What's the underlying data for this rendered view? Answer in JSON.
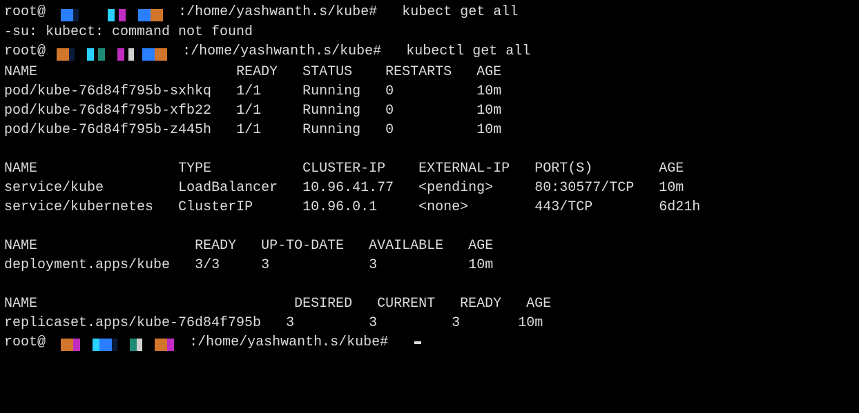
{
  "prompt": {
    "user": "root@",
    "path": ":/home/yashwanth.s/kube#",
    "cmd1": "kubect get all",
    "cmd2": "kubectl get all"
  },
  "err": "-su: kubect: command not found",
  "pods": {
    "hdr": {
      "name": "NAME",
      "ready": "READY",
      "status": "STATUS",
      "restarts": "RESTARTS",
      "age": "AGE"
    },
    "rows": [
      {
        "name": "pod/kube-76d84f795b-sxhkq",
        "ready": "1/1",
        "status": "Running",
        "restarts": "0",
        "age": "10m"
      },
      {
        "name": "pod/kube-76d84f795b-xfb22",
        "ready": "1/1",
        "status": "Running",
        "restarts": "0",
        "age": "10m"
      },
      {
        "name": "pod/kube-76d84f795b-z445h",
        "ready": "1/1",
        "status": "Running",
        "restarts": "0",
        "age": "10m"
      }
    ]
  },
  "svcs": {
    "hdr": {
      "name": "NAME",
      "type": "TYPE",
      "cip": "CLUSTER-IP",
      "eip": "EXTERNAL-IP",
      "ports": "PORT(S)",
      "age": "AGE"
    },
    "rows": [
      {
        "name": "service/kube",
        "type": "LoadBalancer",
        "cip": "10.96.41.77",
        "eip": "<pending>",
        "ports": "80:30577/TCP",
        "age": "10m"
      },
      {
        "name": "service/kubernetes",
        "type": "ClusterIP",
        "cip": "10.96.0.1",
        "eip": "<none>",
        "ports": "443/TCP",
        "age": "6d21h"
      }
    ]
  },
  "deps": {
    "hdr": {
      "name": "NAME",
      "ready": "READY",
      "u2d": "UP-TO-DATE",
      "avail": "AVAILABLE",
      "age": "AGE"
    },
    "rows": [
      {
        "name": "deployment.apps/kube",
        "ready": "3/3",
        "u2d": "3",
        "avail": "3",
        "age": "10m"
      }
    ]
  },
  "rs": {
    "hdr": {
      "name": "NAME",
      "desired": "DESIRED",
      "current": "CURRENT",
      "ready": "READY",
      "age": "AGE"
    },
    "rows": [
      {
        "name": "replicaset.apps/kube-76d84f795b",
        "desired": "3",
        "current": "3",
        "ready": "3",
        "age": "10m"
      }
    ]
  }
}
